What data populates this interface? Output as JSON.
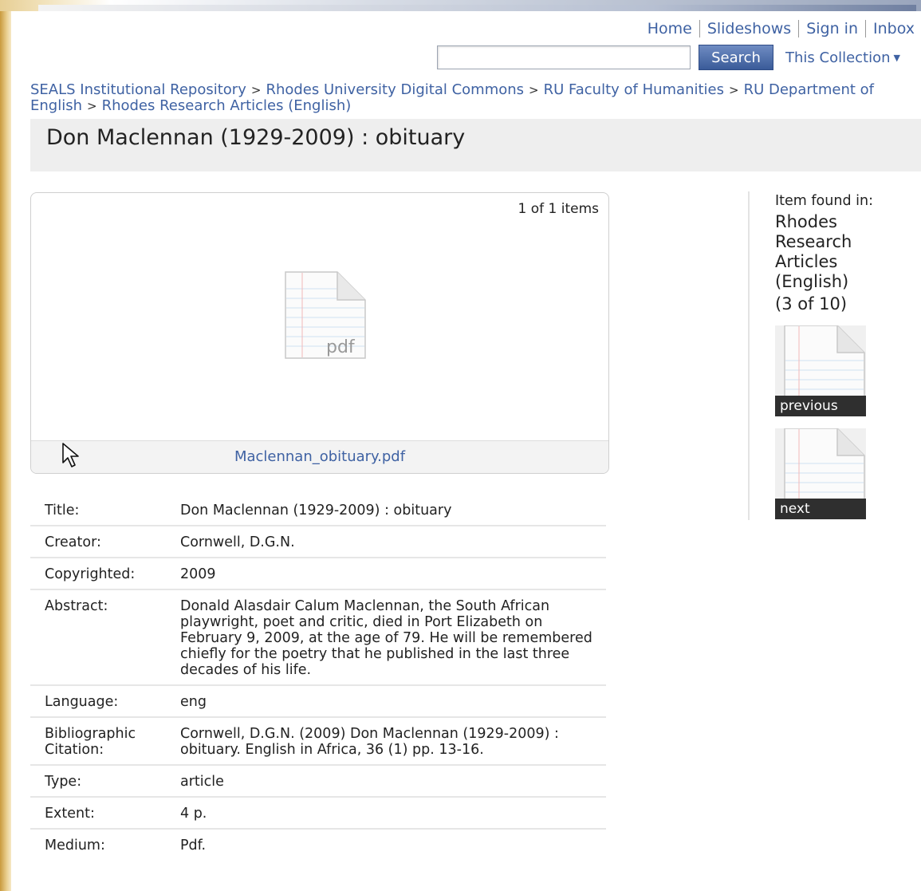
{
  "top_nav": {
    "links": [
      "Home",
      "Slideshows",
      "Sign in",
      "Inbox"
    ]
  },
  "search": {
    "value": "",
    "button_label": "Search",
    "scope_label": "This Collection"
  },
  "breadcrumb": [
    "SEALS Institutional Repository",
    "Rhodes University Digital Commons",
    "RU Faculty of Humanities",
    "RU Department of English",
    "Rhodes Research Articles (English)"
  ],
  "page_title": "Don Maclennan (1929-2009) : obituary",
  "viewer": {
    "count_text": "1 of 1 items",
    "file_type_label": "pdf",
    "file_name": "Maclennan_obituary.pdf"
  },
  "metadata": [
    {
      "label": "Title:",
      "value": "Don Maclennan (1929-2009) : obituary"
    },
    {
      "label": "Creator:",
      "value": "Cornwell, D.G.N."
    },
    {
      "label": "Copyrighted:",
      "value": "2009"
    },
    {
      "label": "Abstract:",
      "value": "Donald Alasdair Calum Maclennan, the South African playwright, poet and critic, died in Port Elizabeth on February 9, 2009, at the age of 79. He will be remembered chiefly for the poetry that he published in the last three decades of his life."
    },
    {
      "label": "Language:",
      "value": "eng"
    },
    {
      "label": "Bibliographic Citation:",
      "value": "Cornwell, D.G.N. (2009) Don Maclennan (1929-2009) : obituary. English in Africa, 36 (1) pp. 13-16."
    },
    {
      "label": "Type:",
      "value": "article"
    },
    {
      "label": "Extent:",
      "value": "4 p."
    },
    {
      "label": "Medium:",
      "value": "Pdf."
    }
  ],
  "sidebar": {
    "found_in_label": "Item found in:",
    "collection_name": "Rhodes Research Articles (English)",
    "position_text": "(3 of 10)",
    "previous_label": "previous",
    "next_label": "next"
  },
  "colors": {
    "link": "#3f62a3",
    "search_button": "#3a5b99",
    "title_bar_bg": "#eeeeee"
  }
}
